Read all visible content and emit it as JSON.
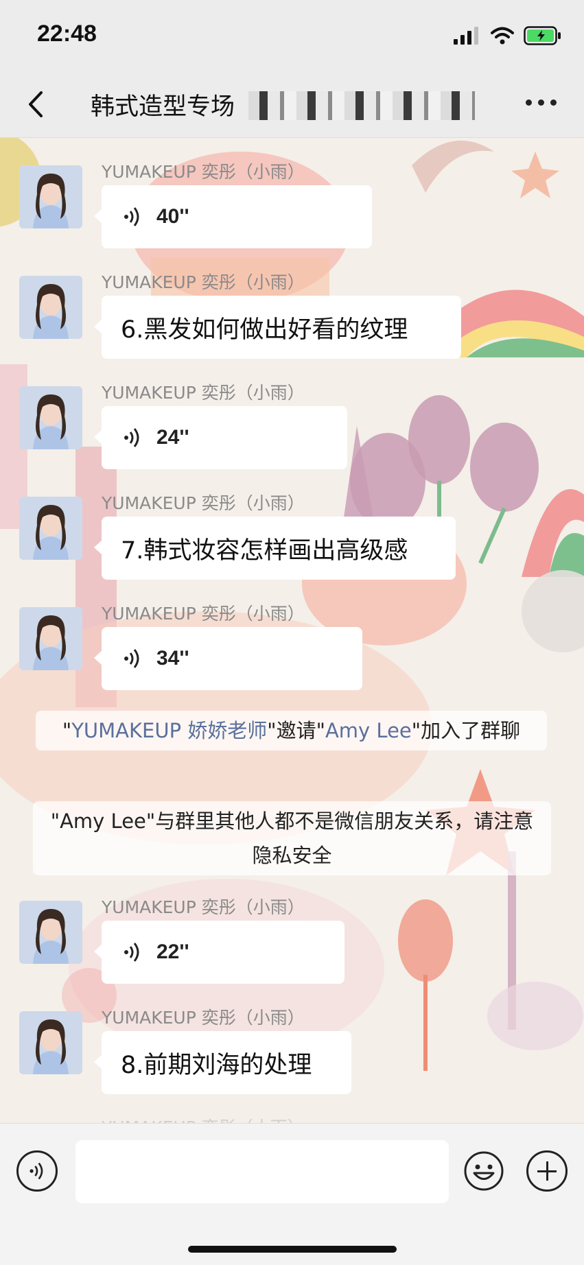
{
  "status_bar": {
    "time": "22:48"
  },
  "nav": {
    "title": "韩式造型专场"
  },
  "messages": [
    {
      "sender": "YUMAKEUP 奕彤（小雨）",
      "type": "voice",
      "duration": "40''"
    },
    {
      "sender": "YUMAKEUP 奕彤（小雨）",
      "type": "text",
      "text": "6.黑发如何做出好看的纹理"
    },
    {
      "sender": "YUMAKEUP 奕彤（小雨）",
      "type": "voice",
      "duration": "24''"
    },
    {
      "sender": "YUMAKEUP 奕彤（小雨）",
      "type": "text",
      "text": "7.韩式妆容怎样画出高级感"
    },
    {
      "sender": "YUMAKEUP 奕彤（小雨）",
      "type": "voice",
      "duration": "34''"
    },
    {
      "sender": "YUMAKEUP 奕彤（小雨）",
      "type": "voice",
      "duration": "22''"
    },
    {
      "sender": "YUMAKEUP 奕彤（小雨）",
      "type": "text",
      "text": "8.前期刘海的处理"
    }
  ],
  "system_messages": {
    "invite": {
      "q1": "\"",
      "inviter": "YUMAKEUP 娇娇老师",
      "mid": "\"邀请\"",
      "invitee": "Amy Lee",
      "tail": "\"加入了群聊"
    },
    "privacy": "\"Amy Lee\"与群里其他人都不是微信朋友关系，请注意隐私安全"
  },
  "partial_sender": "YUMAKEUP 奕彤（小雨）",
  "input": {
    "placeholder": ""
  },
  "colors": {
    "link": "#5a6f9c",
    "battery": "#4cd964"
  }
}
